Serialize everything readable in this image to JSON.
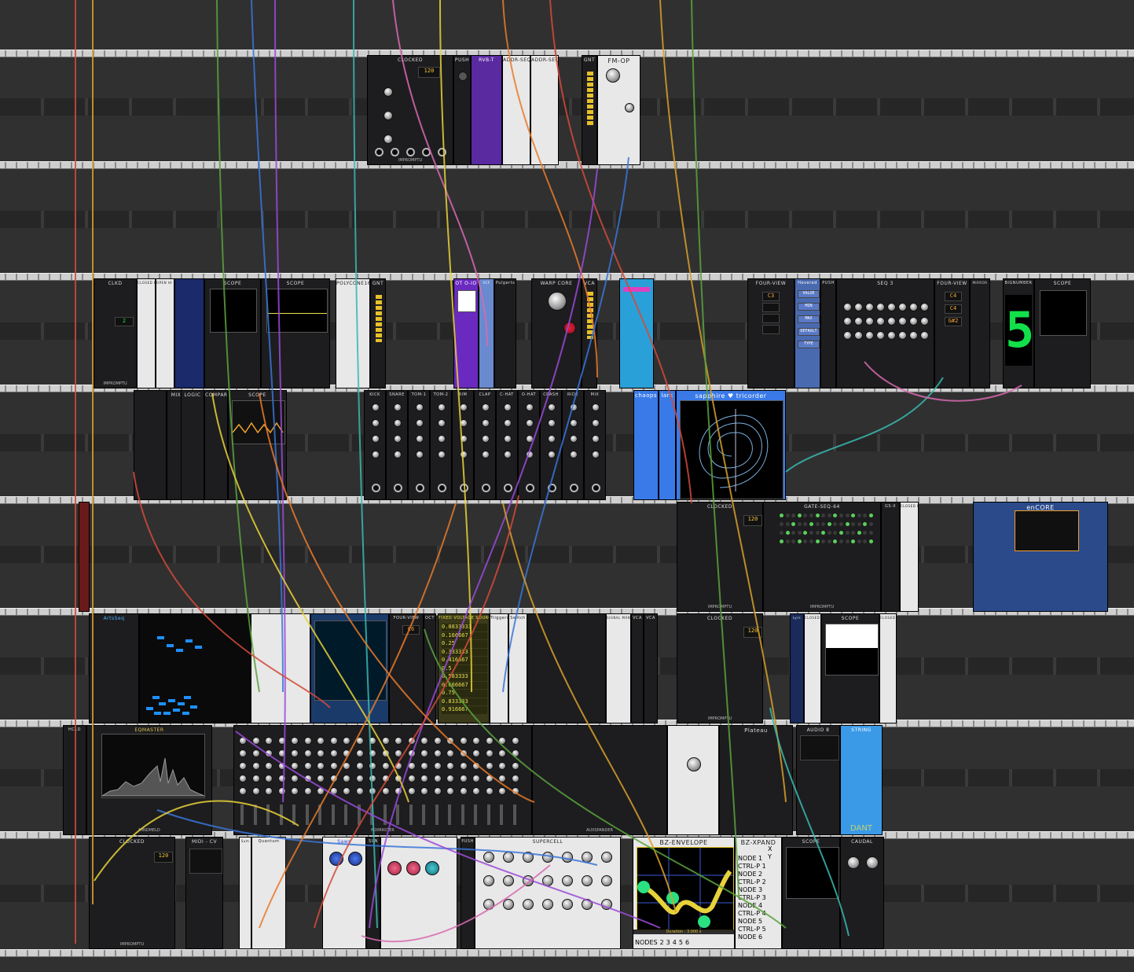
{
  "rack": {
    "rows": [
      {
        "modules": [
          {
            "label": "CLOCKED",
            "footer": "IMPROMPTU",
            "display": "120"
          },
          {
            "label": "PUSH"
          },
          {
            "label": "RVB-T"
          },
          {
            "label": "ADDR-SEQ"
          },
          {
            "label": "ADDR-SEQ"
          },
          {
            "label": "GNT"
          },
          {
            "label": "FM-OP"
          }
        ]
      },
      {
        "modules": [
          {
            "label": "CLKD",
            "footer": "IMPROMPTU"
          },
          {
            "label": "CLOSED HI HATS"
          },
          {
            "label": "OPEN HI HATS"
          },
          {
            "label": "SCOPE"
          },
          {
            "label": "SCOPE"
          },
          {
            "label": "POLYCONE16"
          },
          {
            "label": "GNT"
          },
          {
            "label": "OT O-IO"
          },
          {
            "label": "VCF"
          },
          {
            "label": "Pulgerts"
          },
          {
            "label": "WARP CORE"
          },
          {
            "label": "VCA"
          },
          {
            "label": "FOUR-VIEW",
            "notes": [
              "C3",
              "",
              "",
              ""
            ]
          },
          {
            "label": "Hovered",
            "fields": [
              "VALUE",
              "MIN",
              "MAX",
              "DEFAULT",
              "TYPE"
            ]
          },
          {
            "label": "PUSH"
          },
          {
            "label": "SEQ 3"
          },
          {
            "label": "FOUR-VIEW",
            "notes": [
              "C4",
              "C4",
              "G#2",
              ""
            ]
          },
          {
            "label": "MIRROR"
          },
          {
            "label": "BIGNUMBER",
            "value": "5"
          },
          {
            "label": "SCOPE"
          }
        ]
      },
      {
        "modules": [
          {
            "label": "MIX"
          },
          {
            "label": "LOGIC"
          },
          {
            "label": "COMPARE"
          },
          {
            "label": "SCOPE"
          },
          {
            "label": "KICK"
          },
          {
            "label": "SNARE"
          },
          {
            "label": "TOM-1"
          },
          {
            "label": "TOM-2"
          },
          {
            "label": "RIM"
          },
          {
            "label": "CLAP"
          },
          {
            "label": "C-HAT"
          },
          {
            "label": "O-HAT"
          },
          {
            "label": "CRASH"
          },
          {
            "label": "RIDE"
          },
          {
            "label": "MIX"
          },
          {
            "label": "chaops"
          },
          {
            "label": "lark"
          },
          {
            "label": "sapphire ♥ tricorder"
          }
        ]
      },
      {
        "modules": [
          {
            "label": "CLOCKED",
            "footer": "IMPROMPTU",
            "displays": [
              "120"
            ]
          },
          {
            "label": "GATE-SEQ-64",
            "footer": "IMPROMPTU"
          },
          {
            "label": "GS-X"
          },
          {
            "label": "CLOSED HI HATS"
          },
          {
            "label": "enCORE"
          }
        ]
      },
      {
        "modules": [
          {
            "label": "ArtsSeq"
          },
          {
            "label": "FOUR-VIEW",
            "notes": [
              "C6"
            ]
          },
          {
            "label": "OCT"
          },
          {
            "label": "FIXED VOLTAGE SOURCE",
            "values": [
              "0.0833333",
              "0.166667",
              "0.25",
              "0.333333",
              "0.416667",
              "0.5",
              "0.583333",
              "0.666667",
              "0.75",
              "0.833333",
              "0.916667"
            ]
          },
          {
            "label": "Triggers"
          },
          {
            "label": "Switch"
          },
          {
            "label": "SIGNAL MANIFOLD"
          },
          {
            "label": "VCA"
          },
          {
            "label": "VCA"
          },
          {
            "label": "CLOCKED",
            "footer": "IMPROMPTU",
            "display": "120"
          },
          {
            "label": "Lyre"
          },
          {
            "label": "CLOSED HI HATS"
          },
          {
            "label": "SCOPE"
          },
          {
            "label": "CLOSED HI HATS"
          }
        ]
      },
      {
        "modules": [
          {
            "label": "HCLD"
          },
          {
            "label": "EQMASTER",
            "footer": "MINDMELD"
          },
          {
            "label": "MIXMASTER",
            "footer": "MINDMELD"
          },
          {
            "label": "AUXSPANDER"
          },
          {
            "label": "Plateau"
          },
          {
            "label": "AUDIO 8"
          },
          {
            "label": "STRING"
          },
          {
            "label": "DANT"
          }
        ]
      },
      {
        "modules": [
          {
            "label": "CLOCKED",
            "footer": "IMPROMPTU",
            "display": "120"
          },
          {
            "label": "MIDI - CV"
          },
          {
            "label": "Sum"
          },
          {
            "label": "Quantum"
          },
          {
            "label": "Saws"
          },
          {
            "label": "SUN"
          },
          {
            "label": "PUSH"
          },
          {
            "label": "SUPERCELL"
          },
          {
            "label": "BZ-ENVELOPE",
            "footer_labels": [
              "NODES",
              "2",
              "3",
              "4",
              "5",
              "6"
            ],
            "status": "Duration : 3.000 s"
          },
          {
            "label": "BZ-XPAND",
            "lines": [
              "NODE 1",
              "CTRL-P 1",
              "NODE 2",
              "CTRL-P 2",
              "NODE 3",
              "CTRL-P 3",
              "NODE 4",
              "CTRL-P 4",
              "NODE 5",
              "CTRL-P 5",
              "NODE 6"
            ],
            "axes": [
              "X",
              "Y"
            ]
          },
          {
            "label": "SCOPE"
          },
          {
            "label": "CAUDAL"
          }
        ]
      }
    ]
  },
  "colors": {
    "rail": "#cfcfcf",
    "background": "#2a2a2a",
    "panel_dark": "#1d1d1f",
    "panel_light": "#e8e8e8",
    "led_green": "#12e04a",
    "cable_palette": [
      "#d24a3a",
      "#d8a02a",
      "#5aa23c",
      "#3a74d8",
      "#9a4ad8",
      "#3ab8b0",
      "#d86ab0",
      "#e8d23a",
      "#e87a2a"
    ]
  }
}
